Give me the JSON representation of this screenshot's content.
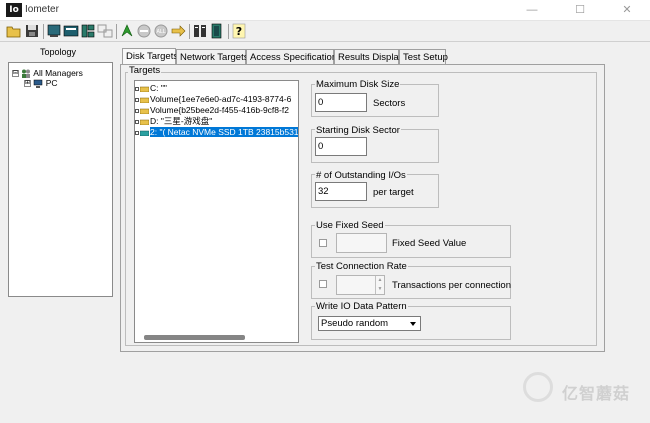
{
  "app": {
    "title": "Iometer",
    "icon_text": "Io"
  },
  "window_controls": [
    "—",
    "☐",
    "✕"
  ],
  "toolbar": {
    "icons": [
      "open-icon",
      "save-icon",
      "new-worker-icon",
      "new-network-worker-icon",
      "new-disk-worker-icon",
      "duplicate-worker-icon",
      "start-icon",
      "stop-icon",
      "stop-all-icon",
      "reset-workers-icon",
      "new-manager-icon",
      "quit-icon",
      "about-icon"
    ]
  },
  "topology": {
    "label": "Topology",
    "tree": [
      {
        "label": "All Managers",
        "expander": "⊟"
      },
      {
        "label": "PC",
        "expander": "⊞"
      }
    ]
  },
  "tabs": [
    "Disk Targets",
    "Network Targets",
    "Access Specifications",
    "Results Display",
    "Test Setup"
  ],
  "targets": {
    "title": "Targets",
    "items": [
      {
        "label": "C: \"\"",
        "selected": false
      },
      {
        "label": "Volume{1ee7e6e0-ad7c-4193-8774-6",
        "selected": false
      },
      {
        "label": "Volume{b25bee2d-f455-416b-9cf8-f2",
        "selected": false
      },
      {
        "label": "D: \"三星-游戏盘\"",
        "selected": false
      },
      {
        "label": "2: \"( Netac NVMe SSD 1TB 23815b531",
        "selected": true
      }
    ]
  },
  "max_disk_size": {
    "title": "Maximum Disk Size",
    "value": "0",
    "unit": "Sectors"
  },
  "starting_sector": {
    "title": "Starting Disk Sector",
    "value": "0"
  },
  "outstanding": {
    "title": "# of Outstanding I/Os",
    "value": "32",
    "unit": "per target"
  },
  "fixed_seed": {
    "title": "Use Fixed Seed",
    "label": "Fixed Seed Value"
  },
  "test_connection": {
    "title": "Test Connection Rate",
    "label": "Transactions per connection"
  },
  "write_pattern": {
    "title": "Write IO Data Pattern",
    "selected": "Pseudo random"
  },
  "watermark": {
    "text": "亿智蘑菇"
  }
}
